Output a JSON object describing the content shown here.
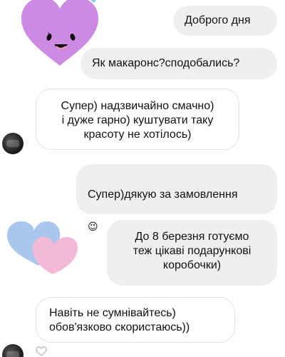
{
  "messages": [
    {
      "id": "m1",
      "direction": "outgoing",
      "text": "Доброго дня"
    },
    {
      "id": "m2",
      "direction": "outgoing",
      "text": "Як макаронс?сподобались?"
    },
    {
      "id": "m3",
      "direction": "incoming",
      "text": "Супер) надзвичайно смачно)\nі дуже гарно) куштувати таку\nкрасоту не хотілось)"
    },
    {
      "id": "m4",
      "direction": "outgoing",
      "text": "Супер)дякую за замовлення",
      "emoji": "😉"
    },
    {
      "id": "m5",
      "direction": "outgoing",
      "text": "До 8 березня готуємо\nтеж цікаві подарункові\nкоробочки)"
    },
    {
      "id": "m6",
      "direction": "incoming",
      "text": "Навіть не сумнівайтесь)\nобов'язково скористаюсь))"
    }
  ],
  "stickers": [
    {
      "id": "s1",
      "name": "purple-heart-smiley-sticker",
      "colors": {
        "heart": "#cc8ae3",
        "face": "#111111"
      }
    },
    {
      "id": "s2",
      "name": "blue-pink-hearts-sticker",
      "colors": {
        "back": "#a9c7ec",
        "front": "#f4b9d6"
      }
    }
  ],
  "icons": {
    "avatar": "avatar-icon",
    "heart": "heart-outline-icon",
    "wink": "winking-face-emoji"
  },
  "colors": {
    "outgoing_bubble": "#efefef",
    "incoming_bubble_border": "#e3e3e3",
    "background": "#ffffff"
  }
}
